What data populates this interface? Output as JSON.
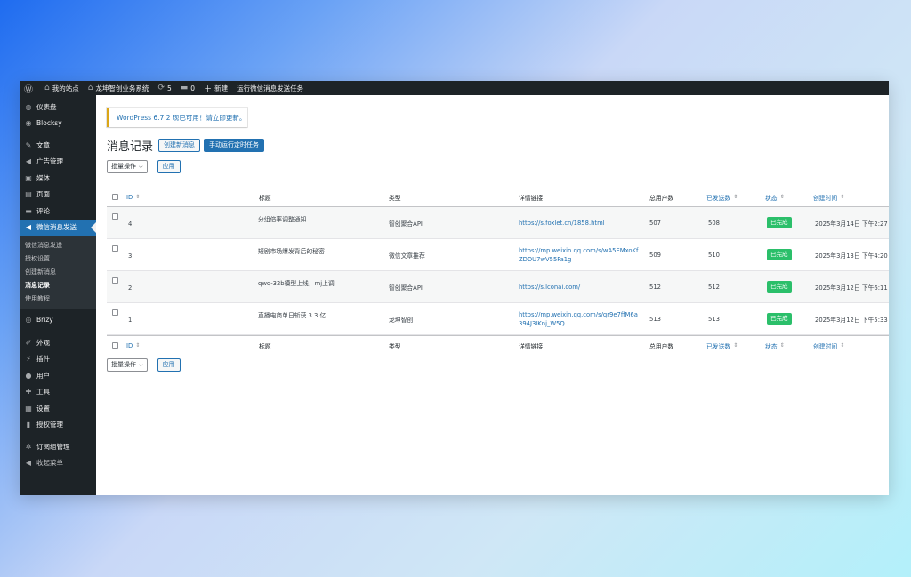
{
  "admin_bar": {
    "site_name": "我的站点",
    "site_name2": "龙坤智创业务系统",
    "updates_count": "5",
    "comments_count": "0",
    "new_label": "新建",
    "run_task": "运行微信消息发送任务"
  },
  "sidebar": {
    "items": [
      {
        "label": "仪表盘",
        "icon": "dashboard-icon",
        "glyph": "◍"
      },
      {
        "label": "Blocksy",
        "icon": "blocksy-icon",
        "glyph": "◉"
      },
      {
        "label": "文章",
        "icon": "pin-icon",
        "glyph": "✎"
      },
      {
        "label": "广告管理",
        "icon": "megaphone-icon",
        "glyph": "◀"
      },
      {
        "label": "媒体",
        "icon": "media-icon",
        "glyph": "▣"
      },
      {
        "label": "页面",
        "icon": "page-icon",
        "glyph": "▤"
      },
      {
        "label": "评论",
        "icon": "comment-icon",
        "glyph": "▬"
      },
      {
        "label": "微信消息发送",
        "icon": "megaphone-icon",
        "glyph": "◀"
      }
    ],
    "submenu": [
      "微信消息发送",
      "授权设置",
      "创建新消息",
      "消息记录",
      "使用教程"
    ],
    "items2": [
      {
        "label": "Brizy",
        "icon": "brizy-icon",
        "glyph": "◎"
      },
      {
        "label": "外观",
        "icon": "brush-icon",
        "glyph": "✐"
      },
      {
        "label": "插件",
        "icon": "plugin-icon",
        "glyph": "⚡"
      },
      {
        "label": "用户",
        "icon": "user-icon",
        "glyph": "●"
      },
      {
        "label": "工具",
        "icon": "wrench-icon",
        "glyph": "✚"
      },
      {
        "label": "设置",
        "icon": "settings-icon",
        "glyph": "▦"
      },
      {
        "label": "授权管理",
        "icon": "lock-icon",
        "glyph": "▮"
      },
      {
        "label": "订阅组管理",
        "icon": "gear-icon",
        "glyph": "✲"
      },
      {
        "label": "收起菜单",
        "icon": "collapse-icon",
        "glyph": "◀"
      }
    ]
  },
  "notice": {
    "text": "WordPress 6.7.2 现已可用！",
    "link": "请立即更新。"
  },
  "page": {
    "title": "消息记录",
    "create_btn": "创建新消息",
    "run_btn": "手动运行定时任务",
    "bulk_label": "批量操作",
    "apply_label": "应用"
  },
  "table": {
    "columns": {
      "id": "ID",
      "title": "标题",
      "type": "类型",
      "link": "详情链接",
      "total": "总用户数",
      "sent": "已发送数",
      "status": "状态",
      "created": "创建时间"
    },
    "rows": [
      {
        "id": "4",
        "title": "分组倍率调整通知",
        "type": "智创聚合API",
        "link": "https://s.foxlet.cn/1858.html",
        "total": "507",
        "sent": "508",
        "status": "已完成",
        "created": "2025年3月14日 下午2:27"
      },
      {
        "id": "3",
        "title": "短剧市场爆发背后的秘密",
        "type": "微信文章推荐",
        "link": "https://mp.weixin.qq.com/s/wA5EMxoKfZDDU7wV55Fa1g",
        "total": "509",
        "sent": "510",
        "status": "已完成",
        "created": "2025年3月13日 下午4:20"
      },
      {
        "id": "2",
        "title": "qwq-32b模型上线，mj上调",
        "type": "智创聚合API",
        "link": "https://s.lconai.com/",
        "total": "512",
        "sent": "512",
        "status": "已完成",
        "created": "2025年3月12日 下午6:11"
      },
      {
        "id": "1",
        "title": "直播电商单日斩获 3.3 亿",
        "type": "龙坤智创",
        "link": "https://mp.weixin.qq.com/s/qr9e7ffM6a394J3IKnj_W5Q",
        "total": "513",
        "sent": "513",
        "status": "已完成",
        "created": "2025年3月12日 下午5:33"
      }
    ]
  },
  "colors": {
    "accent": "#2271b1",
    "sidebar_bg": "#1d2327",
    "badge_green": "#2bbf6a"
  }
}
